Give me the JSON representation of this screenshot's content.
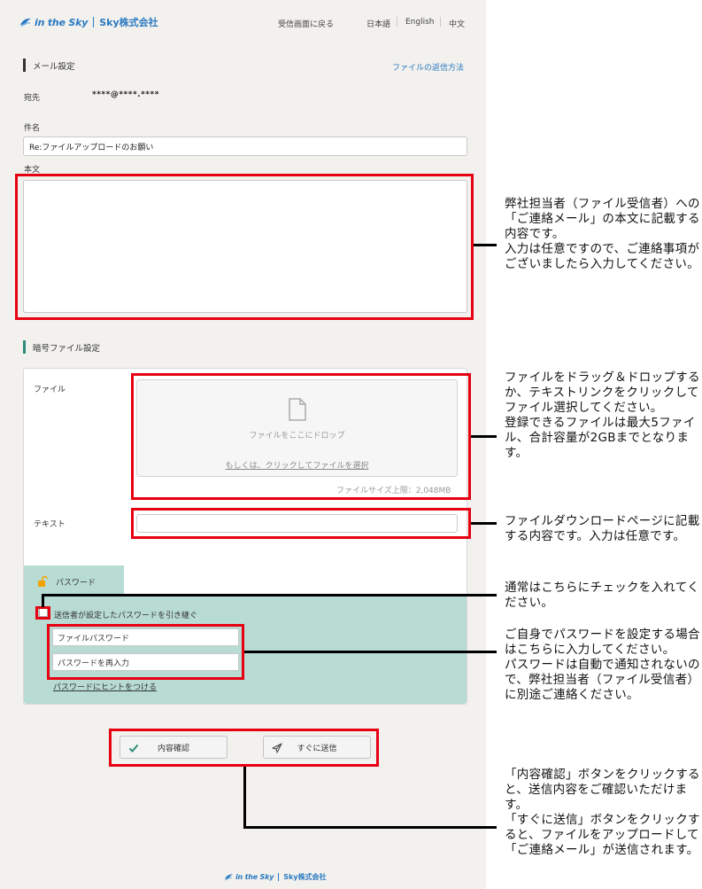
{
  "header": {
    "logo_text": "in the Sky",
    "logo_company": "Sky株式会社",
    "back_link": "受信画面に戻る",
    "languages": [
      "日本語",
      "English",
      "中文"
    ]
  },
  "mail_settings": {
    "title": "メール設定",
    "reply_link": "ファイルの返信方法",
    "to_label": "宛先",
    "to_value": "****@****.****",
    "subject_label": "件名",
    "subject_value": "Re:ファイルアップロードのお願い",
    "body_label": "本文"
  },
  "file_settings": {
    "title": "暗号ファイル設定",
    "file_label": "ファイル",
    "drop_text": "ファイルをここにドロップ",
    "select_link": "もしくは、クリックしてファイルを選択",
    "size_limit": "ファイルサイズ上限：2,048MB",
    "text_label": "テキスト"
  },
  "password": {
    "tab_label": "パスワード",
    "inherit_label": "送信者が設定したパスワードを引き継ぐ",
    "password_placeholder": "ファイルパスワード",
    "confirm_placeholder": "パスワードを再入力",
    "hint_link": "パスワードにヒントをつける"
  },
  "buttons": {
    "confirm": "内容確認",
    "send": "すぐに送信"
  },
  "footer": {
    "logo_text": "in the Sky",
    "logo_company": "Sky株式会社"
  },
  "annotations": {
    "body": "弊社担当者（ファイル受信者）への「ご連絡メール」の本文に記載する内容です。\n入力は任意ですので、ご連絡事項がございましたら入力してください。",
    "file": "ファイルをドラッグ＆ドロップするか、テキストリンクをクリックしてファイル選択してください。\n登録できるファイルは最大5ファイル、合計容量が2GBまでとなります。",
    "text": "ファイルダウンロードページに記載する内容です。入力は任意です。",
    "checkbox": "通常はこちらにチェックを入れてください。",
    "password": "ご自身でパスワードを設定する場合はこちらに入力してください。\nパスワードは自動で通知されないので、弊社担当者（ファイル受信者）に別途ご連絡ください。",
    "buttons": "「内容確認」ボタンをクリックすると、送信内容をご確認いただけます。\n「すぐに送信」ボタンをクリックすると、ファイルをアップロードして「ご連絡メール」が送信されます。"
  },
  "colors": {
    "accent_blue": "#2a79c1",
    "section_bar_dark": "#333333",
    "section_bar_teal": "#2e8b7a",
    "password_bg": "#b8dbd3",
    "callout_red": "#e60012"
  }
}
